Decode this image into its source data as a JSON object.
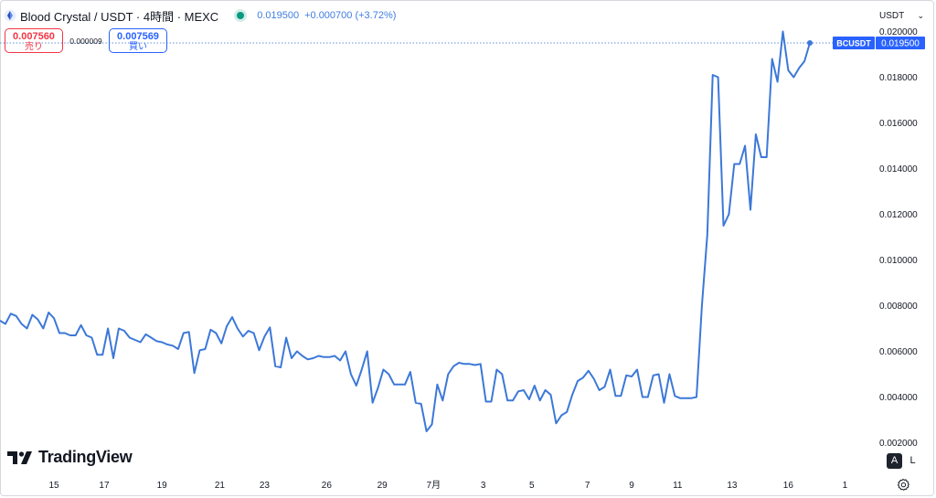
{
  "header": {
    "symbol_title": "Blood Crystal / USDT · 4時間 · MEXC",
    "last_price": "0.019500",
    "change": "+0.000700 (+3.72%)"
  },
  "trade": {
    "sell_price": "0.007560",
    "sell_label": "売り",
    "spread": "0.000009",
    "buy_price": "0.007569",
    "buy_label": "買い"
  },
  "currency_selector": {
    "value": "USDT"
  },
  "brand": {
    "name": "TradingView"
  },
  "scale_buttons": {
    "auto": "A",
    "log": "L"
  },
  "colors": {
    "line": "#3c78d8",
    "accent": "#2962ff",
    "sell": "#f23645",
    "live": "#089981"
  },
  "chart_data": {
    "type": "line",
    "series": [
      {
        "name": "BCUSDT",
        "values": [
          0.00735,
          0.0072,
          0.00765,
          0.00755,
          0.0072,
          0.007,
          0.0076,
          0.0074,
          0.007,
          0.0077,
          0.00745,
          0.0068,
          0.0068,
          0.0067,
          0.0067,
          0.00715,
          0.0067,
          0.0066,
          0.00585,
          0.00585,
          0.007,
          0.0057,
          0.007,
          0.0069,
          0.0066,
          0.0065,
          0.0064,
          0.00675,
          0.0066,
          0.00645,
          0.0064,
          0.0063,
          0.00625,
          0.0061,
          0.0068,
          0.00685,
          0.00505,
          0.00605,
          0.0061,
          0.00695,
          0.0068,
          0.00635,
          0.0071,
          0.0075,
          0.007,
          0.00665,
          0.0069,
          0.0068,
          0.00605,
          0.00665,
          0.00705,
          0.00535,
          0.0053,
          0.0066,
          0.0057,
          0.006,
          0.0058,
          0.00565,
          0.0057,
          0.0058,
          0.00575,
          0.00575,
          0.0058,
          0.0056,
          0.006,
          0.005,
          0.0045,
          0.0052,
          0.006,
          0.00375,
          0.0044,
          0.0052,
          0.005,
          0.00455,
          0.00455,
          0.00455,
          0.0051,
          0.00375,
          0.0037,
          0.0025,
          0.0028,
          0.00455,
          0.00385,
          0.005,
          0.00535,
          0.0055,
          0.00545,
          0.00545,
          0.0054,
          0.00545,
          0.0038,
          0.0038,
          0.0052,
          0.005,
          0.00385,
          0.00385,
          0.00425,
          0.0043,
          0.0039,
          0.0045,
          0.00385,
          0.0043,
          0.0041,
          0.00285,
          0.0032,
          0.00335,
          0.0041,
          0.0047,
          0.00485,
          0.00515,
          0.0048,
          0.0043,
          0.00445,
          0.0052,
          0.00405,
          0.00405,
          0.00495,
          0.0049,
          0.0052,
          0.004,
          0.004,
          0.00495,
          0.005,
          0.00375,
          0.005,
          0.00405,
          0.00395,
          0.00395,
          0.00395,
          0.004,
          0.008,
          0.0111,
          0.0181,
          0.018,
          0.0115,
          0.012,
          0.0142,
          0.0142,
          0.015,
          0.0122,
          0.0155,
          0.0145,
          0.0145,
          0.0188,
          0.0178,
          0.02,
          0.0183,
          0.018,
          0.0184,
          0.0187,
          0.0195
        ]
      }
    ],
    "x_tick_labels": [
      "15",
      "17",
      "19",
      "21",
      "23",
      "26",
      "29",
      "7月",
      "3",
      "5",
      "7",
      "9",
      "11",
      "13",
      "16",
      "1"
    ],
    "x_tick_index": [
      10,
      19.3,
      30,
      40.7,
      49,
      60.5,
      70.8,
      80.3,
      89.5,
      98.5,
      108.8,
      117,
      125.5,
      135.6,
      146,
      156.5
    ],
    "yticks": [
      "0.020000",
      "0.018000",
      "0.016000",
      "0.014000",
      "0.012000",
      "0.010000",
      "0.008000",
      "0.006000",
      "0.004000",
      "0.002000"
    ],
    "ytick_values": [
      0.02,
      0.018,
      0.016,
      0.014,
      0.012,
      0.01,
      0.008,
      0.006,
      0.004,
      0.002
    ],
    "ylim": [
      0.00058,
      0.02138
    ],
    "last_label": {
      "symbol": "BCUSDT",
      "value": "0.019500"
    },
    "grid": false,
    "legend": "none"
  }
}
